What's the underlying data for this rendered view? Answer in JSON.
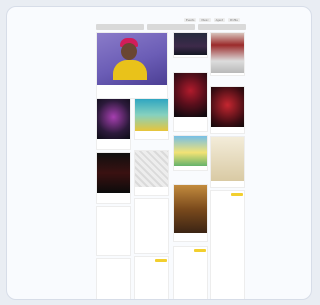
{
  "brand": "",
  "nav": [
    "Events",
    "Music",
    "Agent",
    "Profile"
  ],
  "filters": [
    "",
    "",
    ""
  ],
  "accent_color": "#f2cf2e",
  "cards": []
}
